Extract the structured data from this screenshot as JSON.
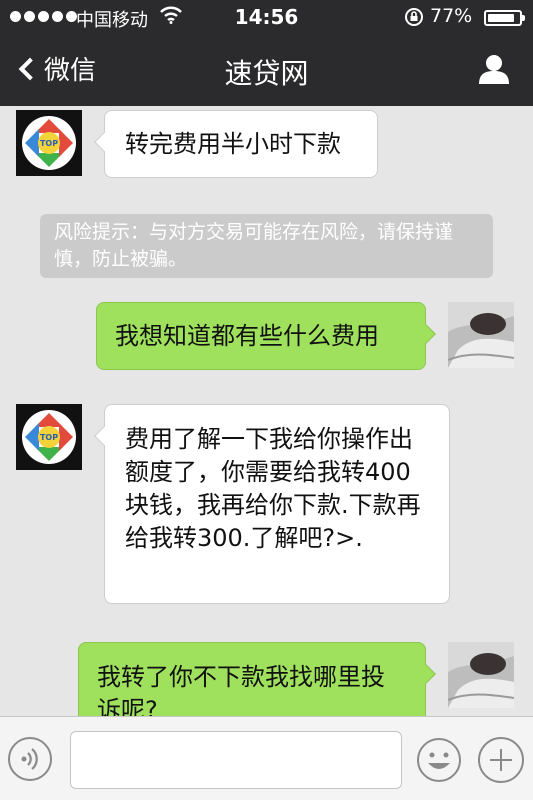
{
  "status_bar": {
    "carrier": "中国移动",
    "time": "14:56",
    "battery": "77%",
    "battery_level": 0.77,
    "icons": [
      "signal-dots-icon",
      "wifi-icon",
      "rotation-lock-icon",
      "battery-icon"
    ]
  },
  "nav": {
    "back_label": "微信",
    "title": "速贷网",
    "icons": [
      "chevron-left-icon",
      "profile-icon"
    ]
  },
  "messages": [
    {
      "side": "in",
      "text": "转完费用半小时下款"
    },
    {
      "side": "system",
      "text": "风险提示：与对方交易可能存在风险，请保持谨慎，防止被骗。"
    },
    {
      "side": "out",
      "text": "我想知道都有些什么费用"
    },
    {
      "side": "in",
      "text": "费用了解一下我给你操作出额度了，你需要给我转400块钱，我再给你下款.下款再给我转300.了解吧?>."
    },
    {
      "side": "out",
      "text": "我转了你不下款我找哪里投诉呢?"
    }
  ],
  "avatar_logo": {
    "text": "TOP",
    "icon": "top-logo-icon"
  },
  "input_bar": {
    "value": "",
    "icons": [
      "voice-icon",
      "emoji-icon",
      "plus-icon"
    ]
  }
}
